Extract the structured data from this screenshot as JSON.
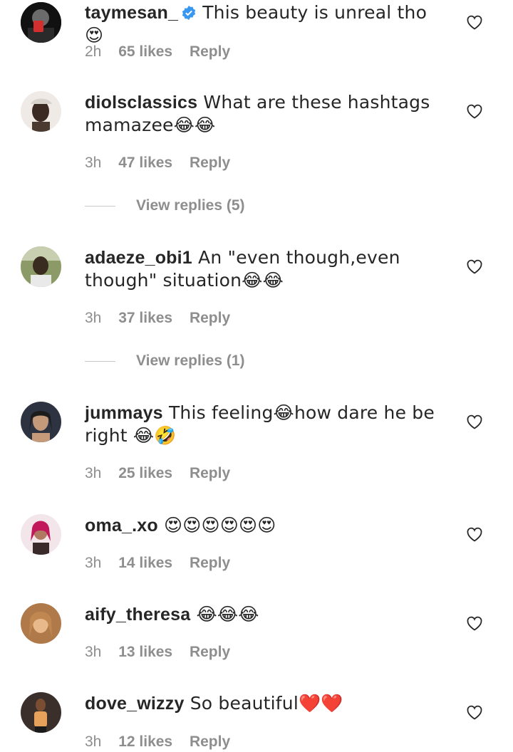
{
  "comments": [
    {
      "username": "taymesan_",
      "verified": true,
      "text": " This beauty is unreal tho 😍",
      "time": "2h",
      "likes": "65 likes",
      "reply_label": "Reply",
      "avatar_color": "#1a1a1a",
      "avatar_accent": "#d32f2f"
    },
    {
      "username": "diolsclassics",
      "text": " What are these hashtags mamazee😂😂",
      "time": "3h",
      "likes": "47 likes",
      "reply_label": "Reply",
      "view_replies": "View replies (5)",
      "avatar_color": "#e6e1dc",
      "avatar_accent": "#3b2a22"
    },
    {
      "username": "adaeze_obi1",
      "text": " An \"even though,even though\" situation😂😂",
      "time": "3h",
      "likes": "37 likes",
      "reply_label": "Reply",
      "view_replies": "View replies (1)",
      "avatar_color": "#7d8a5c",
      "avatar_accent": "#3a2b20"
    },
    {
      "username": "jummays",
      "text": " This feeling😂how dare he be right 😂🤣",
      "time": "3h",
      "likes": "25 likes",
      "reply_label": "Reply",
      "avatar_color": "#2d3340",
      "avatar_accent": "#c49a7a"
    },
    {
      "username": "oma_.xo",
      "text": " 😍😍😍😍😍😍",
      "time": "3h",
      "likes": "14 likes",
      "reply_label": "Reply",
      "avatar_color": "#f2e6ea",
      "avatar_accent": "#c2185b"
    },
    {
      "username": "aify_theresa",
      "text": " 😂😂😂",
      "time": "3h",
      "likes": "13 likes",
      "reply_label": "Reply",
      "avatar_color": "#b0794a",
      "avatar_accent": "#e8b98a"
    },
    {
      "username": "dove_wizzy",
      "text": " So beautiful❤️❤️",
      "time": "3h",
      "likes": "12 likes",
      "reply_label": "Reply",
      "avatar_color": "#3a2f2a",
      "avatar_accent": "#e6a15a"
    }
  ],
  "colors": {
    "text": "#262626",
    "meta": "#8e8e8e",
    "verified_badge": "#3897f0"
  }
}
